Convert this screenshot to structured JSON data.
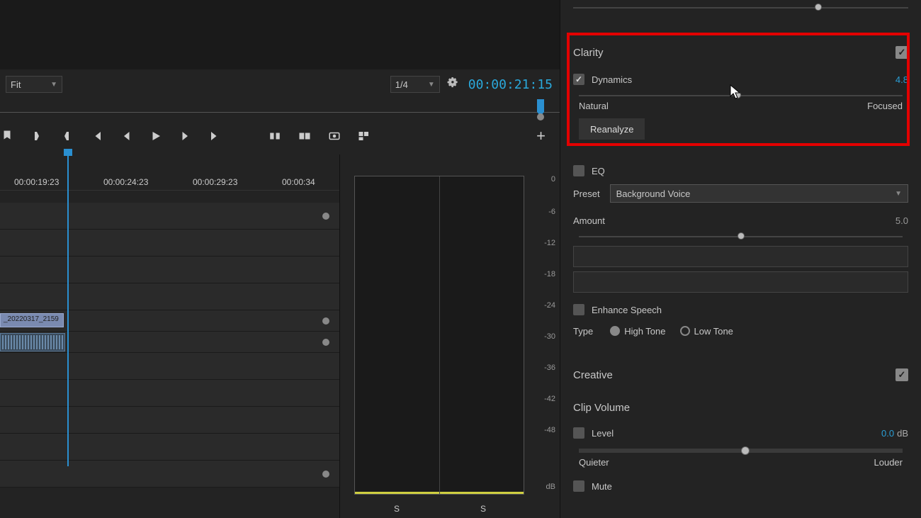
{
  "preview": {
    "fit_label": "Fit",
    "resolution_label": "1/4",
    "timecode": "00:00:21:15"
  },
  "timeline": {
    "times": [
      "00:00:19:23",
      "00:00:24:23",
      "00:00:29:23",
      "00:00:34"
    ],
    "clip_label": "_20220317_2159"
  },
  "meter": {
    "scale": [
      "0",
      "-6",
      "-12",
      "-18",
      "-24",
      "-30",
      "-36",
      "-42",
      "-48"
    ],
    "db_label": "dB",
    "s1": "S",
    "s2": "S"
  },
  "clarity": {
    "title": "Clarity",
    "enabled": true,
    "dynamics_label": "Dynamics",
    "dynamics_value": "4.8",
    "dynamics_min": "Natural",
    "dynamics_max": "Focused",
    "reanalyze": "Reanalyze",
    "eq_label": "EQ",
    "preset_label": "Preset",
    "preset_value": "Background Voice",
    "amount_label": "Amount",
    "amount_value": "5.0",
    "enhance_label": "Enhance Speech",
    "type_label": "Type",
    "high_tone": "High Tone",
    "low_tone": "Low Tone"
  },
  "creative": {
    "title": "Creative",
    "enabled": true
  },
  "clip_volume": {
    "title": "Clip Volume",
    "level_label": "Level",
    "level_value": "0.0",
    "level_unit": "dB",
    "level_min": "Quieter",
    "level_max": "Louder",
    "mute_label": "Mute"
  }
}
